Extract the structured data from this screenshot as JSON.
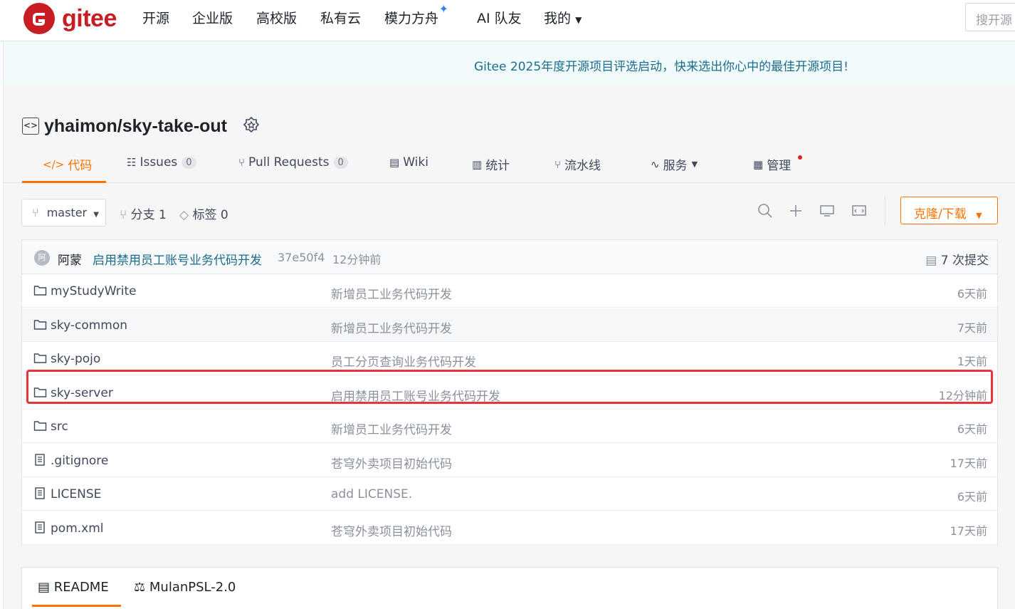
{
  "nav": {
    "brand": "gitee",
    "items": [
      "开源",
      "企业版",
      "高校版",
      "私有云",
      "模力方舟",
      "AI 队友",
      "我的"
    ],
    "search_placeholder": "搜开源"
  },
  "banner": {
    "text": "Gitee 2025年度开源项目评选启动，快来选出你心中的最佳开源项目!"
  },
  "repo": {
    "title": "yhaimon/sky-take-out",
    "tabs": [
      {
        "label": "代码"
      },
      {
        "label": "Issues",
        "count": "0"
      },
      {
        "label": "Pull Requests",
        "count": "0"
      },
      {
        "label": "Wiki"
      },
      {
        "label": "统计"
      },
      {
        "label": "流水线"
      },
      {
        "label": "服务"
      },
      {
        "label": "管理"
      }
    ]
  },
  "toolbar": {
    "branch": "master",
    "branches": "分支 1",
    "tags": "标签 0",
    "clone_label": "克隆/下载"
  },
  "commit": {
    "avatar": "阿",
    "author": "阿蒙",
    "message": "启用禁用员工账号业务代码开发",
    "hash": "37e50f4",
    "time": "12分钟前",
    "count": "7 次提交"
  },
  "files": [
    {
      "type": "folder",
      "name": "myStudyWrite",
      "message": "新增员工业务代码开发",
      "time": "6天前"
    },
    {
      "type": "folder",
      "name": "sky-common",
      "message": "新增员工业务代码开发",
      "time": "7天前"
    },
    {
      "type": "folder",
      "name": "sky-pojo",
      "message": "员工分页查询业务代码开发",
      "time": "1天前"
    },
    {
      "type": "folder",
      "name": "sky-server",
      "message": "启用禁用员工账号业务代码开发",
      "time": "12分钟前"
    },
    {
      "type": "folder",
      "name": "src",
      "message": "新增员工业务代码开发",
      "time": "6天前"
    },
    {
      "type": "file",
      "name": ".gitignore",
      "message": "苍穹外卖项目初始代码",
      "time": "17天前"
    },
    {
      "type": "file",
      "name": "LICENSE",
      "message": "add LICENSE.",
      "time": "6天前"
    },
    {
      "type": "file",
      "name": "pom.xml",
      "message": "苍穹外卖项目初始代码",
      "time": "17天前"
    }
  ],
  "readme": {
    "tabs": [
      "README",
      "MulanPSL-2.0"
    ]
  },
  "colors": {
    "accent": "#fe7300",
    "brand": "#c71d23",
    "highlight": "#e8333a"
  }
}
